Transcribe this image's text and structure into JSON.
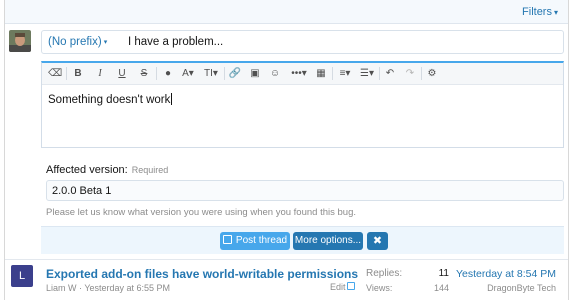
{
  "filter_bar": {
    "filters_label": "Filters",
    "caret": "▾"
  },
  "title_row": {
    "prefix_label": "(No prefix)",
    "prefix_caret": "▾",
    "title_value": "I have a problem..."
  },
  "toolbar": {
    "eraser": "⌫",
    "bold": "B",
    "italic": "I",
    "underline": "U",
    "strike": "S",
    "color": "●",
    "font": "A▾",
    "size": "TI▾",
    "link": "🔗",
    "image": "▣",
    "smilies": "☺",
    "more": "•••▾",
    "media": "▦",
    "align": "≡▾",
    "list": "☰▾",
    "undo": "↶",
    "redo": "↷",
    "settings": "⚙"
  },
  "editor": {
    "body_text": "Something doesn't work"
  },
  "affected_version": {
    "label": "Affected version:",
    "required": "Required",
    "value": "2.0.0 Beta 1",
    "hint": "Please let us know what version you were using when you found this bug."
  },
  "submit": {
    "post_label": "Post thread",
    "more_label": "More options...",
    "cancel_label": "✖"
  },
  "thread": {
    "avatar_letter": "L",
    "avatar_color": "#3b3f8c",
    "title": "Exported add-on files have world-writable permissions",
    "meta": "Liam W · Yesterday at 6:55 PM",
    "edit_label": "Edit",
    "replies_label": "Replies:",
    "replies_value": "11",
    "views_label": "Views:",
    "views_value": "144",
    "last_post_date": "Yesterday at 8:54 PM",
    "last_post_user": "DragonByte Tech"
  },
  "colors": {
    "link": "#2577b1",
    "accent": "#47a7eb",
    "button_dark": "#2577b1"
  }
}
